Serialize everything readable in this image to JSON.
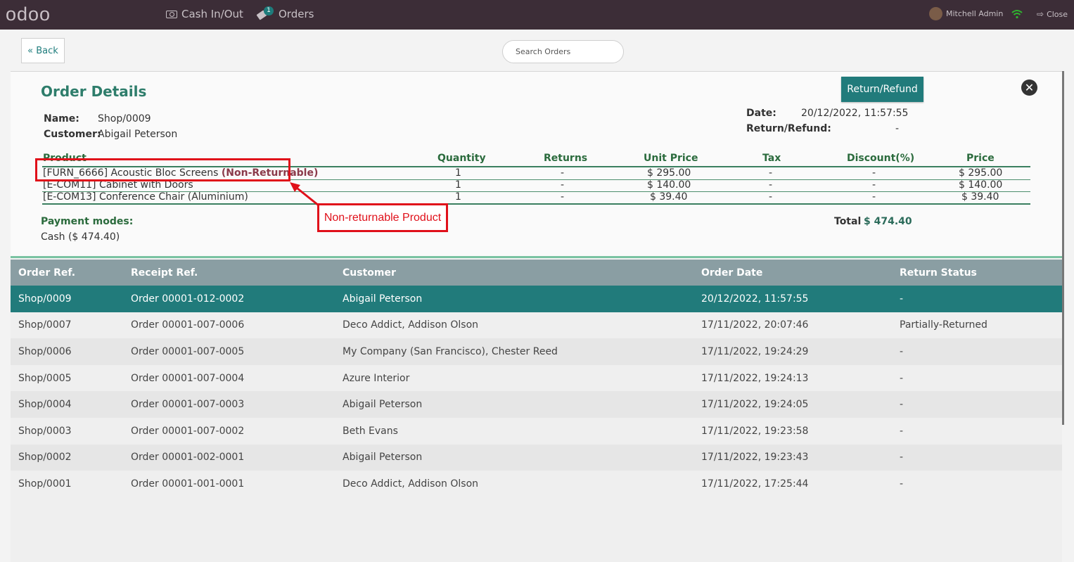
{
  "topbar": {
    "logo": "odoo",
    "cash_label": "Cash In/Out",
    "orders_label": "Orders",
    "orders_badge": "1",
    "user_name": "Mitchell Admin",
    "close_label": "Close"
  },
  "controls": {
    "back_label": "« Back",
    "search_placeholder": "Search Orders"
  },
  "details": {
    "title": "Order Details",
    "refund_button": "Return/Refund",
    "name_label": "Name:",
    "name_value": "Shop/0009",
    "customer_label": "Customer:",
    "customer_value": "Abigail Peterson",
    "date_label": "Date:",
    "date_value": "20/12/2022, 11:57:55",
    "return_label": "Return/Refund:",
    "return_value": "-",
    "headers": [
      "Product",
      "Quantity",
      "Returns",
      "Unit Price",
      "Tax",
      "Discount(%)",
      "Price"
    ],
    "lines": [
      {
        "product": "[FURN_6666] Acoustic Bloc Screens",
        "flag": "(Non-Returnable)",
        "qty": "1",
        "returns": "-",
        "unit_price": "$ 295.00",
        "tax": "-",
        "discount": "-",
        "price": "$ 295.00"
      },
      {
        "product": "[E-COM11] Cabinet with Doors",
        "flag": "",
        "qty": "1",
        "returns": "-",
        "unit_price": "$ 140.00",
        "tax": "-",
        "discount": "-",
        "price": "$ 140.00"
      },
      {
        "product": "[E-COM13] Conference Chair (Aluminium)",
        "flag": "",
        "qty": "1",
        "returns": "-",
        "unit_price": "$ 39.40",
        "tax": "-",
        "discount": "-",
        "price": "$ 39.40"
      }
    ],
    "payment_label": "Payment modes:",
    "payment_value": "Cash ($ 474.40)",
    "total_label": "Total",
    "total_value": "$ 474.40"
  },
  "annotation": {
    "text": "Non-returnable Product"
  },
  "orders": {
    "headers": [
      "Order Ref.",
      "Receipt Ref.",
      "Customer",
      "Order Date",
      "Return Status"
    ],
    "rows": [
      {
        "ref": "Shop/0009",
        "receipt": "Order 00001-012-0002",
        "customer": "Abigail Peterson",
        "date": "20/12/2022, 11:57:55",
        "status": "-"
      },
      {
        "ref": "Shop/0007",
        "receipt": "Order 00001-007-0006",
        "customer": "Deco Addict, Addison Olson",
        "date": "17/11/2022, 20:07:46",
        "status": "Partially-Returned"
      },
      {
        "ref": "Shop/0006",
        "receipt": "Order 00001-007-0005",
        "customer": "My Company (San Francisco), Chester Reed",
        "date": "17/11/2022, 19:24:29",
        "status": "-"
      },
      {
        "ref": "Shop/0005",
        "receipt": "Order 00001-007-0004",
        "customer": "Azure Interior",
        "date": "17/11/2022, 19:24:13",
        "status": "-"
      },
      {
        "ref": "Shop/0004",
        "receipt": "Order 00001-007-0003",
        "customer": "Abigail Peterson",
        "date": "17/11/2022, 19:24:05",
        "status": "-"
      },
      {
        "ref": "Shop/0003",
        "receipt": "Order 00001-007-0002",
        "customer": "Beth Evans",
        "date": "17/11/2022, 19:23:58",
        "status": "-"
      },
      {
        "ref": "Shop/0002",
        "receipt": "Order 00001-002-0001",
        "customer": "Abigail Peterson",
        "date": "17/11/2022, 19:23:43",
        "status": "-"
      },
      {
        "ref": "Shop/0001",
        "receipt": "Order 00001-001-0001",
        "customer": "Deco Addict, Addison Olson",
        "date": "17/11/2022, 17:25:44",
        "status": "-"
      }
    ]
  }
}
